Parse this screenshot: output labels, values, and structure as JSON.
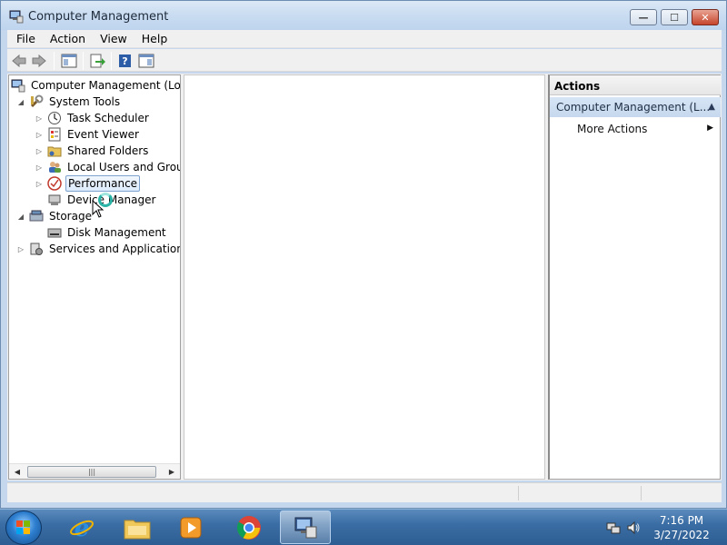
{
  "window": {
    "title": "Computer Management"
  },
  "menu": [
    "File",
    "Action",
    "View",
    "Help"
  ],
  "tree": {
    "root": "Computer Management (Local",
    "system_tools": "System Tools",
    "task_scheduler": "Task Scheduler",
    "event_viewer": "Event Viewer",
    "shared_folders": "Shared Folders",
    "local_users": "Local Users and Groups",
    "performance": "Performance",
    "device_manager": "Device Manager",
    "storage": "Storage",
    "disk_management": "Disk Management",
    "services": "Services and Applications"
  },
  "actions": {
    "header": "Actions",
    "section": "Computer Management (L...",
    "more": "More Actions"
  },
  "clock": {
    "time": "7:16 PM",
    "date": "3/27/2022"
  },
  "colors": {
    "accent": "#3b6ea5",
    "selection": "#dcebfc"
  }
}
